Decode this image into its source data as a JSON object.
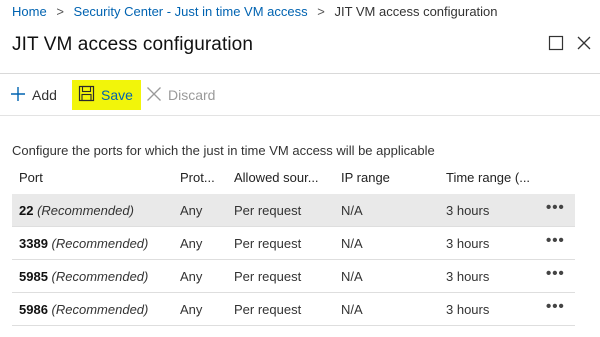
{
  "breadcrumb": {
    "items": [
      {
        "label": "Home"
      },
      {
        "label": "Security Center - Just in time VM access"
      },
      {
        "label": "JIT VM access configuration"
      }
    ],
    "separator": ">"
  },
  "title": "JIT VM access configuration",
  "toolbar": {
    "add_label": "Add",
    "save_label": "Save",
    "discard_label": "Discard"
  },
  "description": "Configure the ports for which the just in time VM access will be applicable",
  "table": {
    "columns": [
      "Port",
      "Prot...",
      "Allowed sour...",
      "IP range",
      "Time range (..."
    ],
    "rows": [
      {
        "port": "22",
        "note": "(Recommended)",
        "protocol": "Any",
        "source": "Per request",
        "ip_range": "N/A",
        "time_range": "3 hours",
        "more": "•••"
      },
      {
        "port": "3389",
        "note": "(Recommended)",
        "protocol": "Any",
        "source": "Per request",
        "ip_range": "N/A",
        "time_range": "3 hours",
        "more": "•••"
      },
      {
        "port": "5985",
        "note": "(Recommended)",
        "protocol": "Any",
        "source": "Per request",
        "ip_range": "N/A",
        "time_range": "3 hours",
        "more": "•••"
      },
      {
        "port": "5986",
        "note": "(Recommended)",
        "protocol": "Any",
        "source": "Per request",
        "ip_range": "N/A",
        "time_range": "3 hours",
        "more": "•••"
      }
    ]
  },
  "colors": {
    "link": "#0063b1",
    "save_highlight": "#f2f50a",
    "selected_row": "#e9e9e9"
  }
}
